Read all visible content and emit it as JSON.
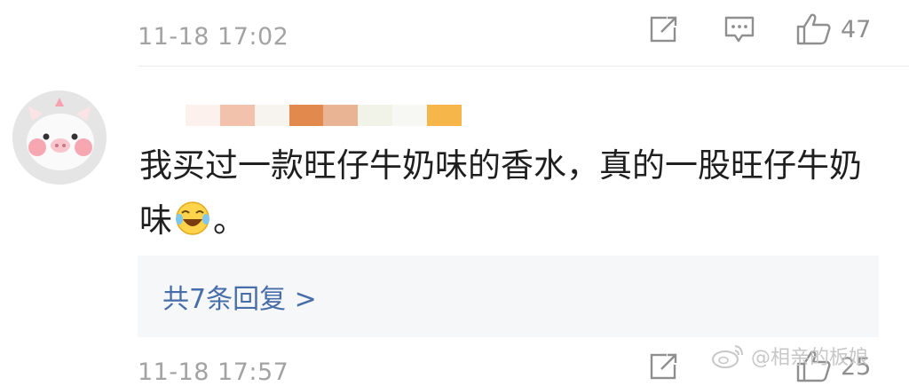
{
  "previous_comment": {
    "timestamp": "11-18 17:02",
    "like_count": "47",
    "actions": [
      "share-icon",
      "comment-icon",
      "thumbs-up-icon"
    ]
  },
  "comment": {
    "avatar_icon": "pig-avatar",
    "username_obscured": true,
    "text": "我买过一款旺仔牛奶味的香水，真的一股旺仔牛奶味",
    "emoji": "laughing-crying-emoji",
    "text_end": "。",
    "replies_link": "共7条回复 >"
  },
  "next_comment": {
    "timestamp": "11-18 17:57",
    "like_count": "25"
  },
  "watermark": {
    "text": "@相亲的板娘"
  },
  "colors": {
    "text": "#1f1f1f",
    "meta": "#a3a3a3",
    "link": "#476ea8",
    "reply_bg": "#f6f7f8",
    "divider": "#ececec"
  }
}
